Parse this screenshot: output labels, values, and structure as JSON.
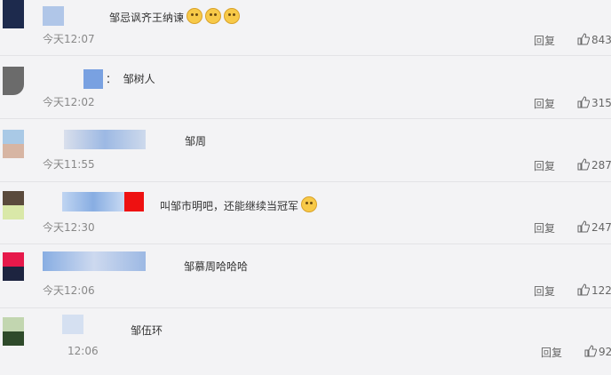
{
  "comments": [
    {
      "text": "邹忌讽齐王纳谏",
      "time": "今天12:07",
      "reply": "回复",
      "likes": "843",
      "emoji_count": 3
    },
    {
      "text": "邹树人",
      "time": "今天12:02",
      "reply": "回复",
      "likes": "315"
    },
    {
      "text": "邹周",
      "time": "今天11:55",
      "reply": "回复",
      "likes": "287"
    },
    {
      "text": "叫邹市明吧，还能继续当冠军",
      "time": "今天12:30",
      "reply": "回复",
      "likes": "247",
      "emoji_count": 1
    },
    {
      "text": "邹慕周哈哈哈",
      "time": "今天12:06",
      "reply": "回复",
      "likes": "122"
    },
    {
      "text": "邹伍环",
      "time": "12:06",
      "reply": "回复",
      "likes": "92"
    }
  ],
  "colon_label": "："
}
